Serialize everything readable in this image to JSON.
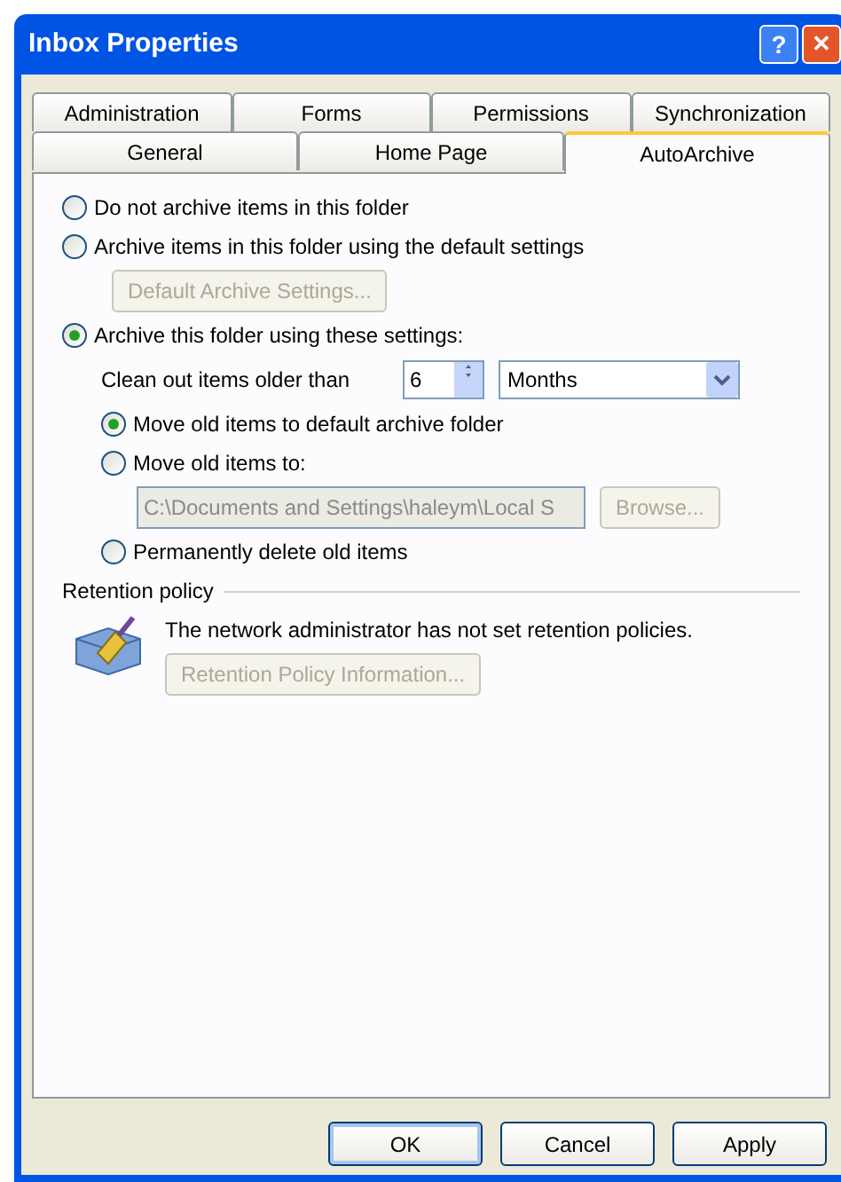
{
  "window": {
    "title": "Inbox Properties",
    "help": "?",
    "close": "✕"
  },
  "tab_rows": [
    [
      {
        "label": "Administration",
        "selected": false
      },
      {
        "label": "Forms",
        "selected": false
      },
      {
        "label": "Permissions",
        "selected": false
      },
      {
        "label": "Synchronization",
        "selected": false
      }
    ],
    [
      {
        "label": "General",
        "selected": false
      },
      {
        "label": "Home Page",
        "selected": false
      },
      {
        "label": "AutoArchive",
        "selected": true
      }
    ]
  ],
  "archive_options": [
    {
      "label": "Do not archive items in this folder",
      "selected": false
    },
    {
      "label": "Archive items in this folder using the default settings",
      "selected": false,
      "button": {
        "label": "Default Archive Settings...",
        "disabled": true
      }
    },
    {
      "label": "Archive this folder using these settings:",
      "selected": true
    }
  ],
  "clean_out": {
    "label": "Clean out items older than",
    "value": "6",
    "unit": "Months"
  },
  "old_item_options": [
    {
      "label": "Move old items to default archive folder",
      "selected": true
    },
    {
      "label": "Move old items to:",
      "selected": false,
      "path": "C:\\Documents and Settings\\haleym\\Local S",
      "browse": {
        "label": "Browse...",
        "disabled": true
      }
    },
    {
      "label": "Permanently delete old items",
      "selected": false
    }
  ],
  "retention": {
    "heading": "Retention policy",
    "message": "The network administrator has not set retention policies.",
    "button": {
      "label": "Retention Policy Information...",
      "disabled": true
    }
  },
  "buttons": [
    "OK",
    "Cancel",
    "Apply"
  ]
}
